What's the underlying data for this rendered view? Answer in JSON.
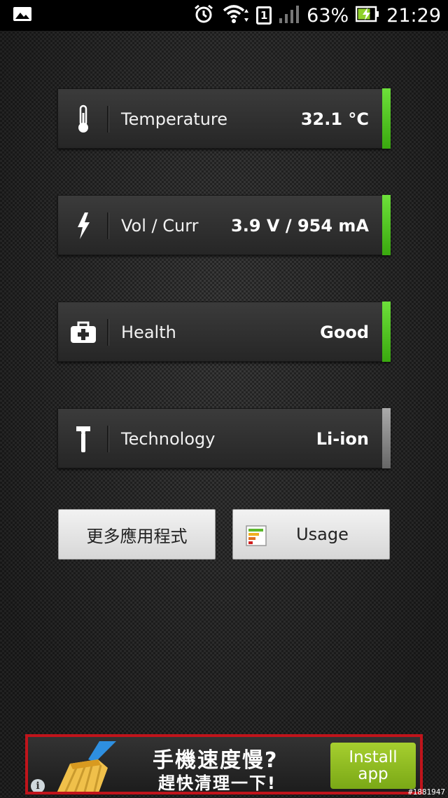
{
  "status_bar": {
    "battery_percent": "63%",
    "time": "21:29",
    "sim_slot": "1",
    "icons": [
      "gallery-icon",
      "alarm-icon",
      "wifi-icon",
      "sim-icon",
      "signal-icon",
      "battery-charging-icon"
    ]
  },
  "cards": [
    {
      "label": "Temperature",
      "value": "32.1 °C",
      "icon": "thermometer-icon",
      "bar_color": "#4cbf1e"
    },
    {
      "label": "Vol / Curr",
      "value": "3.9 V / 954 mA",
      "icon": "lightning-icon",
      "bar_color": "#4cbf1e"
    },
    {
      "label": "Health",
      "value": "Good",
      "icon": "first-aid-kit-icon",
      "bar_color": "#4cbf1e"
    },
    {
      "label": "Technology",
      "value": "Li-ion",
      "icon": "hammer-icon",
      "bar_color": "#8a8a8a"
    }
  ],
  "buttons": {
    "more_apps": "更多應用程式",
    "usage": "Usage"
  },
  "ad": {
    "headline": "手機速度慢?",
    "subline": "趕快清理一下!",
    "install_line1": "Install",
    "install_line2": "app",
    "info": "i",
    "border_color": "#c0141b",
    "install_color": "#8dbb22"
  },
  "watermark": "#1881947"
}
